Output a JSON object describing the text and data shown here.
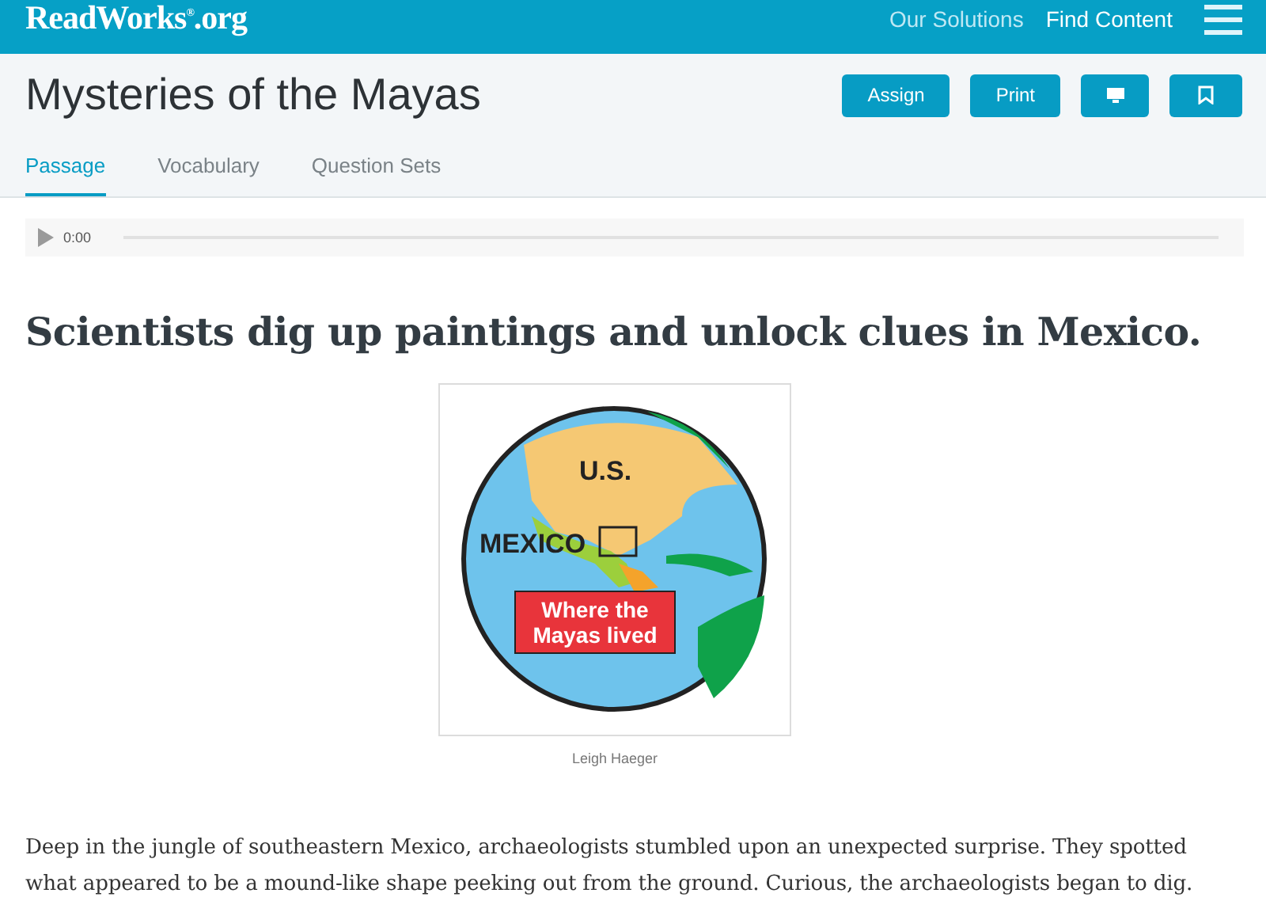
{
  "topbar": {
    "logo": "ReadWorks",
    "logo_mark": "®",
    "logo_suffix": ".org",
    "links": [
      {
        "label": "Our Solutions",
        "selected": false
      },
      {
        "label": "Find Content",
        "selected": true
      }
    ]
  },
  "header": {
    "title": "Mysteries of the Mayas",
    "buttons": [
      {
        "kind": "text",
        "label": "Assign"
      },
      {
        "kind": "text",
        "label": "Print"
      },
      {
        "kind": "screen"
      },
      {
        "kind": "bookmark"
      }
    ]
  },
  "tabs": [
    {
      "label": "Passage",
      "selected": true
    },
    {
      "label": "Vocabulary",
      "selected": false
    },
    {
      "label": "Question Sets",
      "selected": false
    }
  ],
  "audio": {
    "time": "0:00"
  },
  "article": {
    "headline": "Scientists dig up paintings and unlock clues in Mexico.",
    "figure": {
      "labels": [
        "U.S.",
        "MEXICO",
        "Where the Mayas lived"
      ],
      "caption": "Leigh Haeger"
    },
    "paragraph": "Deep in the jungle of southeastern Mexico, archaeologists stumbled upon an unexpected surprise. They spotted what appeared to be a mound-like shape peeking out from the ground. Curious, the archaeologists began to dig."
  }
}
